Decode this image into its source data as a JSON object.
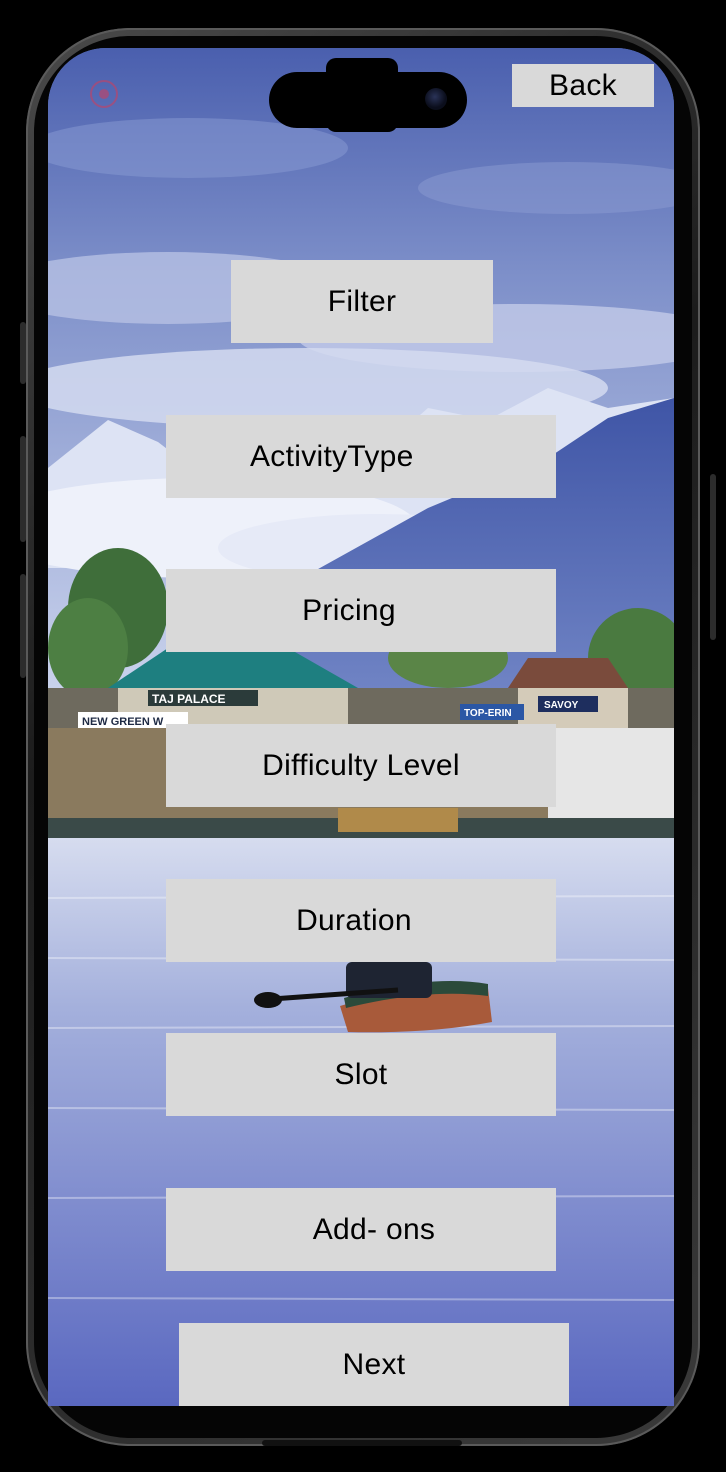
{
  "header": {
    "back_label": "Back"
  },
  "options": {
    "filter_label": "Filter",
    "activity_type_label": "ActivityType",
    "pricing_label": "Pricing",
    "difficulty_level_label": "Difficulty Level",
    "duration_label": "Duration",
    "slot_label": "Slot",
    "addons_label": "Add- ons"
  },
  "footer": {
    "next_label": "Next"
  },
  "background": {
    "scene": "mountain lake with houseboats and a shikara",
    "signs": [
      "TAJ PALACE",
      "NEW GREEN W",
      "TOP-ERIN",
      "SAVOY"
    ]
  },
  "colors": {
    "button_bg": "#d9d9d9",
    "button_text": "#000000",
    "frame": "#000000"
  },
  "icons": {
    "status_indicator": "record-dot-icon",
    "camera": "front-camera-icon"
  }
}
